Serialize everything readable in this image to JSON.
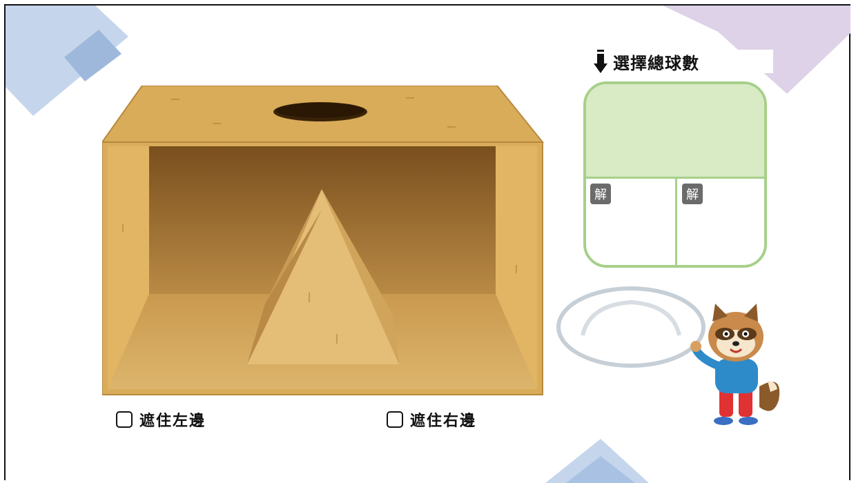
{
  "sheet": {
    "title": "選擇總球數",
    "answer_label_left": "解",
    "answer_label_right": "解"
  },
  "options": {
    "cover_left": "遮住左邊",
    "cover_right": "遮住右邊"
  },
  "colors": {
    "box_wood": "#d9ac5a",
    "box_inner": "#8a5b23",
    "answer_fill": "#d9ebc5",
    "answer_border": "#a6d08a",
    "deco_blue": "#b8cde8",
    "deco_purple": "#d9cfe6"
  },
  "icons": [
    "pencil-arrow-icon",
    "raccoon-mascot",
    "plate-icon",
    "pyramid-shape",
    "wooden-box"
  ]
}
